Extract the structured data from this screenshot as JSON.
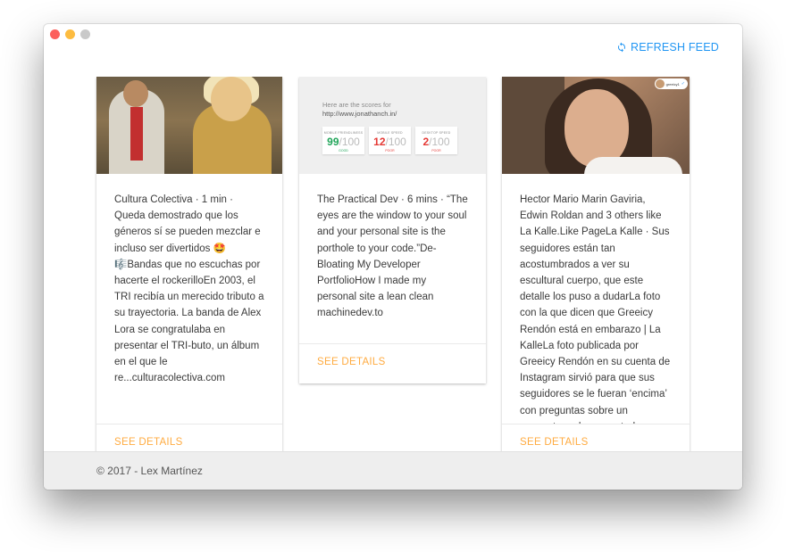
{
  "toolbar": {
    "refresh_label": "REFRESH FEED"
  },
  "cards": [
    {
      "text": "Cultura Colectiva · 1 min · Queda demostrado que los géneros sí se pueden mezclar e incluso ser divertidos 🤩🎼Bandas que no escuchas por hacerte el rockerilloEn 2003, el TRI recibía un merecido tributo a su trayectoria. La banda de Alex Lora se congratulaba en presentar el TRI-buto, un álbum en el que le re...culturacolectiva.com",
      "details_label": "SEE DETAILS"
    },
    {
      "text": "The Practical Dev · 6 mins · “The eyes are the window to your soul and your personal site is the porthole to your code.”De-Bloating My Developer PortfolioHow I made my personal site a lean clean machinedev.to",
      "details_label": "SEE DETAILS",
      "media": {
        "line1": "Here are the scores for",
        "line2": "http://www.jonathanch.in/",
        "scores": [
          {
            "label": "MOBILE FRIENDLINESS",
            "value": "99",
            "of": "/100",
            "status": "GOOD"
          },
          {
            "label": "MOBILE SPEED",
            "value": "12",
            "of": "/100",
            "status": "POOR"
          },
          {
            "label": "DESKTOP SPEED",
            "value": "2",
            "of": "/100",
            "status": "POOR"
          }
        ]
      }
    },
    {
      "text": "Hector Mario Marin Gaviria, Edwin Roldan and 3 others like La Kalle.Like PageLa Kalle · Sus seguidores están tan acostumbrados a ver su escultural cuerpo, que este detalle los puso a dudarLa foto con la que dicen que Greeicy Rendón está en embarazo | La KalleLa foto publicada por Greeicy Rendón en su cuenta de Instagram sirvió para que sus seguidores se le fueran ‘encima’ con preguntas sobre un supuesto embarazo y todo porque en la foto se ve una",
      "details_label": "SEE DETAILS",
      "media": {
        "badge": "greeicy1",
        "verified": "✓"
      }
    }
  ],
  "footer": {
    "text": "© 2017 - Lex Martínez"
  },
  "colors": {
    "accent": "#2196f3",
    "details": "#ffab40",
    "good": "#21a55a",
    "poor": "#e53935"
  }
}
